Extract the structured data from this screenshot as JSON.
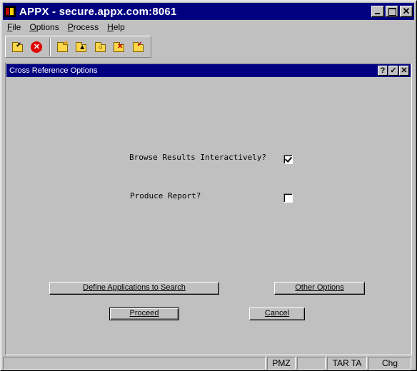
{
  "window": {
    "title": "APPX - secure.appx.com:8061"
  },
  "menu": [
    {
      "label": "File",
      "accel": ""
    },
    {
      "label": "Options",
      "accel": ""
    },
    {
      "label": "Process",
      "accel": "P"
    },
    {
      "label": "Help",
      "accel": ""
    }
  ],
  "toolbar": {
    "icons": [
      "check-folder-icon",
      "stop-icon",
      "folder-star-icon",
      "folder-up-icon",
      "folder-search-icon",
      "folder-x-icon",
      "folder-check-icon"
    ]
  },
  "dialog": {
    "title": "Cross Reference Options",
    "help_button": "?",
    "ok_button": "✓",
    "close_button": "✕",
    "browse_label": "Browse Results Interactively?",
    "browse_checked": true,
    "report_label": "Produce Report?",
    "report_checked": false,
    "define_apps_button": "Define Applications to Search",
    "other_options_button": "Other Options",
    "proceed_button": "Proceed",
    "cancel_button": "Cancel"
  },
  "status": {
    "cells": [
      "",
      "PMZ",
      "",
      "TAR TA",
      "Chg"
    ]
  },
  "colors": {
    "titlebar": "#000080",
    "face": "#c0c0c0"
  }
}
